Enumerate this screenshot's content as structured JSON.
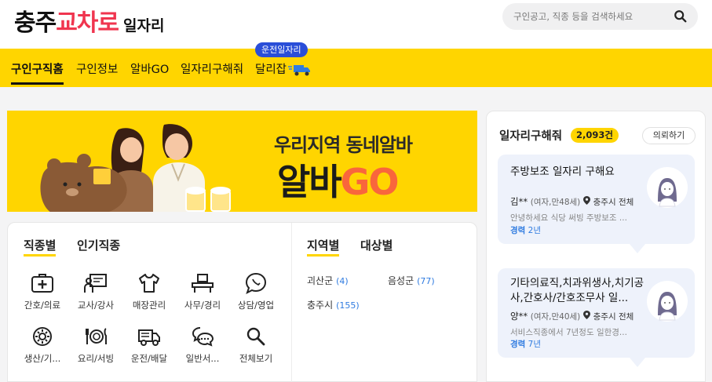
{
  "header": {
    "logo_part1": "충주",
    "logo_part2": "교차로",
    "logo_part3": "일자리",
    "search_placeholder": "구인공고, 직종 등을 검색하세요"
  },
  "nav": {
    "items": [
      "구인구직홈",
      "구인정보",
      "알바GO",
      "일자리구해줘",
      "달리잡"
    ],
    "active": "구인구직홈",
    "tooltip": "운전일자리"
  },
  "banner": {
    "line1": "우리지역 동네알바",
    "line2_a": "알바",
    "line2_b": "GO"
  },
  "categories": {
    "tabs_left": [
      "직종별",
      "인기직종"
    ],
    "items": [
      {
        "label": "간호/의료",
        "icon": "first-aid-kit-icon"
      },
      {
        "label": "교사/강사",
        "icon": "teacher-board-icon"
      },
      {
        "label": "매장관리",
        "icon": "shirt-icon"
      },
      {
        "label": "사무/경리",
        "icon": "office-desk-icon"
      },
      {
        "label": "상담/영업",
        "icon": "phone-chat-icon"
      },
      {
        "label": "생산/기...",
        "icon": "gear-icon"
      },
      {
        "label": "요리/서빙",
        "icon": "dining-icon"
      },
      {
        "label": "운전/배달",
        "icon": "truck-icon"
      },
      {
        "label": "일반서...",
        "icon": "chat-bubbles-icon"
      },
      {
        "label": "전체보기",
        "icon": "search-icon"
      }
    ],
    "tabs_right": [
      "지역별",
      "대상별"
    ],
    "regions": [
      {
        "name": "괴산군",
        "count": "(4)"
      },
      {
        "name": "음성군",
        "count": "(77)"
      },
      {
        "name": "충주시",
        "count": "(155)"
      }
    ]
  },
  "sidebar": {
    "title": "일자리구해줘",
    "count": "2,093건",
    "request_button": "의뢰하기",
    "cards": [
      {
        "title": "주방보조 일자리 구해요",
        "name": "김**",
        "info": "(여자,만48세)",
        "location": "충주시 전체",
        "desc": "안녕하세요 식당 써빙 주방보조 ...",
        "exp_label": "경력",
        "exp_value": "2년"
      },
      {
        "title": "기타의료직,치과위생사,치기공사,간호사/간호조무사 일...",
        "name": "양**",
        "info": "(여자,만40세)",
        "location": "충주시 전체",
        "desc": "서비스직종에서 7년정도 일한경...",
        "exp_label": "경력",
        "exp_value": "7년"
      }
    ]
  },
  "colors": {
    "brand_yellow": "#ffd500",
    "logo_red": "#f0354f",
    "accent_blue": "#2f7be0",
    "tooltip_blue": "#2a4ed8"
  }
}
